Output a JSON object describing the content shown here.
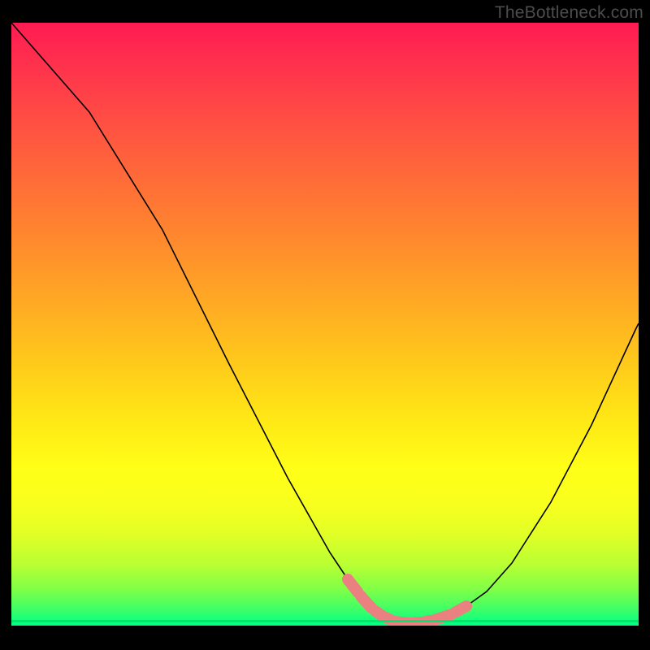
{
  "watermark": "TheBottleneck.com",
  "colors": {
    "background": "#000000",
    "gradient_top": "#ff1b52",
    "gradient_bottom": "#00ff85",
    "curve": "#000000",
    "highlight": "#ea8080"
  },
  "chart_data": {
    "type": "line",
    "title": "",
    "xlabel": "",
    "ylabel": "",
    "xlim": [
      0,
      100
    ],
    "ylim": [
      0,
      100
    ],
    "x": [
      0,
      5,
      10,
      15,
      20,
      25,
      30,
      35,
      40,
      45,
      48,
      50,
      52,
      55,
      58,
      60,
      62,
      65,
      68,
      70,
      75,
      80,
      85,
      90,
      95,
      100
    ],
    "values": [
      100,
      94,
      86,
      77,
      67,
      57,
      47,
      37,
      27,
      16,
      10,
      7,
      4,
      1.5,
      0.8,
      0.5,
      0.5,
      0.6,
      0.8,
      1.2,
      4,
      10,
      19,
      30,
      42,
      55
    ],
    "highlight_range_x": [
      52,
      72
    ],
    "annotations": []
  }
}
